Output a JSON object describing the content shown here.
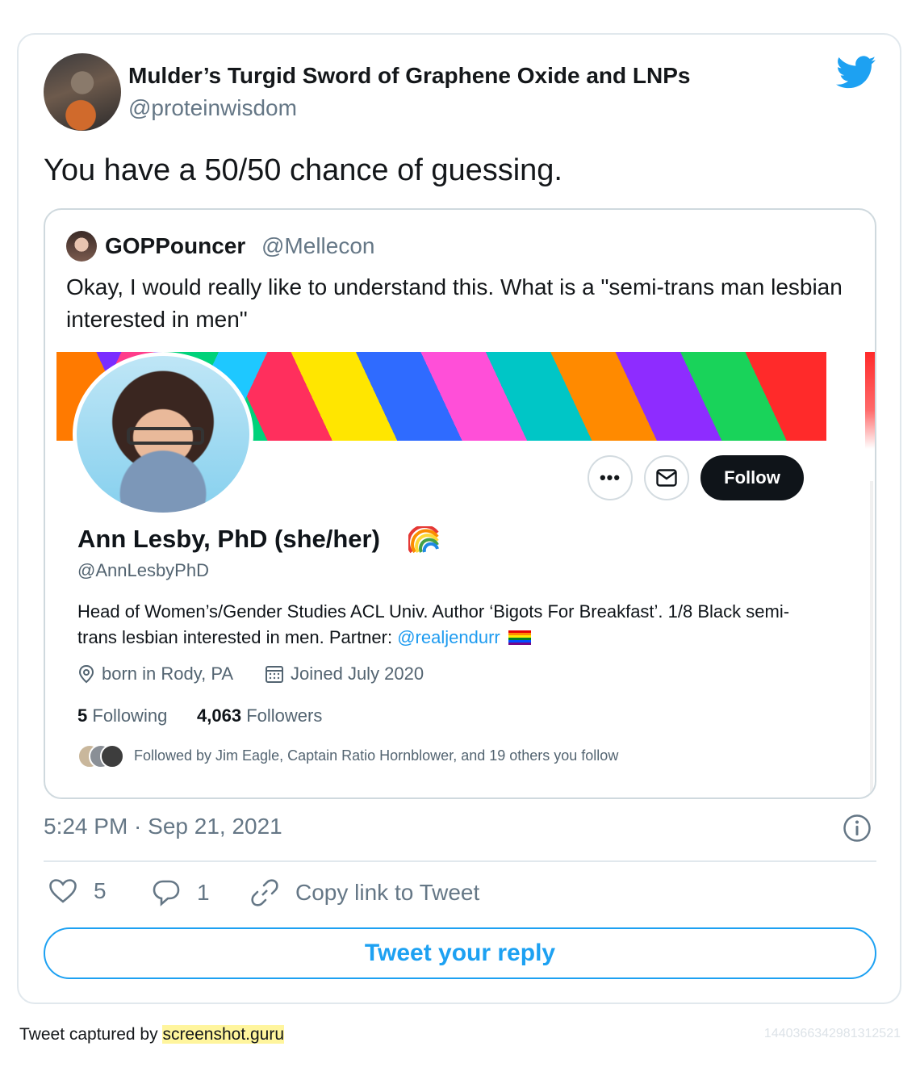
{
  "tweet": {
    "author_name": "Mulder’s Turgid Sword of Graphene Oxide and LNPs",
    "author_handle": "@proteinwisdom",
    "text": "You have a 50/50 chance of guessing.",
    "timestamp": "5:24 PM · Sep 21, 2021",
    "likes": "5",
    "replies": "1",
    "copy_link_label": "Copy link to Tweet",
    "reply_button": "Tweet your reply"
  },
  "quoted": {
    "author_name": "GOPPouncer",
    "author_handle": "@Mellecon",
    "text": "Okay, I would really like to understand this.  What is a \"semi-trans man lesbian interested in men\""
  },
  "profile": {
    "name": "Ann Lesby, PhD (she/her)",
    "handle": "@AnnLesbyPhD",
    "bio": "Head of Women’s/Gender Studies ACL Univ. Author ‘Bigots For Breakfast’. 1/8 Black semi-trans lesbian interested in men. Partner: ",
    "bio_link": "@realjendurr",
    "location": "born in Rody, PA",
    "joined": "Joined July 2020",
    "following_count": "5",
    "following_label": "Following",
    "followers_count": "4,063",
    "followers_label": "Followers",
    "followed_by": "Followed by Jim Eagle, Captain Ratio Hornblower, and 19 others you follow",
    "follow_button": "Follow",
    "more_button": "•••"
  },
  "footer": {
    "captured_by": "Tweet captured by ",
    "site": "screenshot.guru",
    "tweet_id": "1440366342981312521"
  },
  "colors": {
    "twitter_blue": "#1da1f2",
    "link_blue": "#1d9bf0",
    "muted": "#657786",
    "border": "#e1e8ed",
    "highlight": "#fff59d"
  },
  "icons": [
    "twitter-bird-icon",
    "heart-icon",
    "reply-bubble-icon",
    "link-icon",
    "info-icon",
    "mail-icon",
    "location-pin-icon",
    "calendar-icon",
    "rainbow-icon",
    "pride-flag-icon"
  ]
}
